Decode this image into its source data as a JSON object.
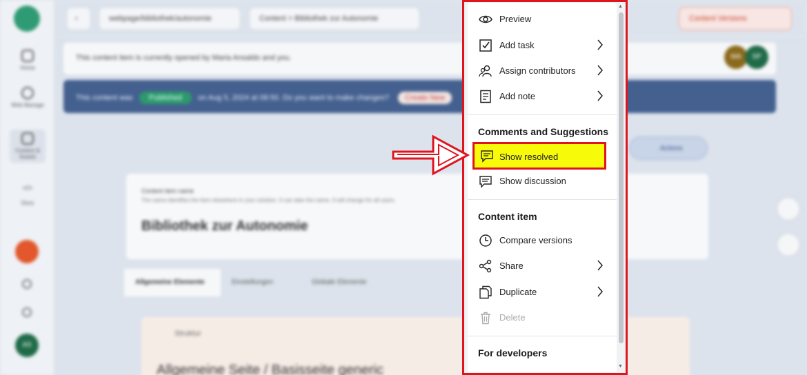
{
  "background": {
    "rail": {
      "items": [
        "Home",
        "Web Manage",
        "Content & Assets",
        "Docs"
      ]
    },
    "topbar": {
      "pill1": "webpage/bibliothek/autonomie",
      "pill2": "Content > Bibliothek zur Autonomie",
      "pill3": "Content Versions"
    },
    "open_banner": "This content item is currently opened by Maria Ansaldo and you.",
    "avatars": [
      "MA",
      "SP"
    ],
    "blue_banner": {
      "prefix": "This content was",
      "chip": "Published",
      "middle": "on Aug 5, 2024 at 08:50. Do you want to make changes?",
      "chip2": "Create New"
    },
    "right_button": "Actions",
    "title_card": {
      "label": "Content item name",
      "sub": "The name identifies the item elsewhere in your solution. It can take the name. It will change for all users.",
      "name": "Bibliothek zur Autonomie"
    },
    "tabs": [
      "Allgemeine Elemente",
      "Einstellungen",
      "Globale Elemente"
    ],
    "section": {
      "label": "Struktur",
      "heading": "Allgemeine Seite / Basisseite generic"
    },
    "rail_badge": "AS"
  },
  "menu": {
    "items_top": [
      {
        "label": "Preview",
        "icon": "eye-icon",
        "chevron": false
      },
      {
        "label": "Add task",
        "icon": "checkbox-icon",
        "chevron": true
      },
      {
        "label": "Assign contributors",
        "icon": "users-icon",
        "chevron": true
      },
      {
        "label": "Add note",
        "icon": "note-icon",
        "chevron": true
      }
    ],
    "comments_heading": "Comments and Suggestions",
    "comments_items": [
      {
        "label": "Show resolved",
        "icon": "comment-icon"
      },
      {
        "label": "Show discussion",
        "icon": "discussion-icon"
      }
    ],
    "content_heading": "Content item",
    "content_items": [
      {
        "label": "Compare versions",
        "icon": "clock-icon",
        "chevron": false
      },
      {
        "label": "Share",
        "icon": "share-icon",
        "chevron": true
      },
      {
        "label": "Duplicate",
        "icon": "duplicate-icon",
        "chevron": true
      },
      {
        "label": "Delete",
        "icon": "trash-icon",
        "chevron": false
      }
    ],
    "dev_heading": "For developers"
  },
  "colors": {
    "highlight": "#f7fb0a",
    "annotation_red": "#e0141e"
  }
}
